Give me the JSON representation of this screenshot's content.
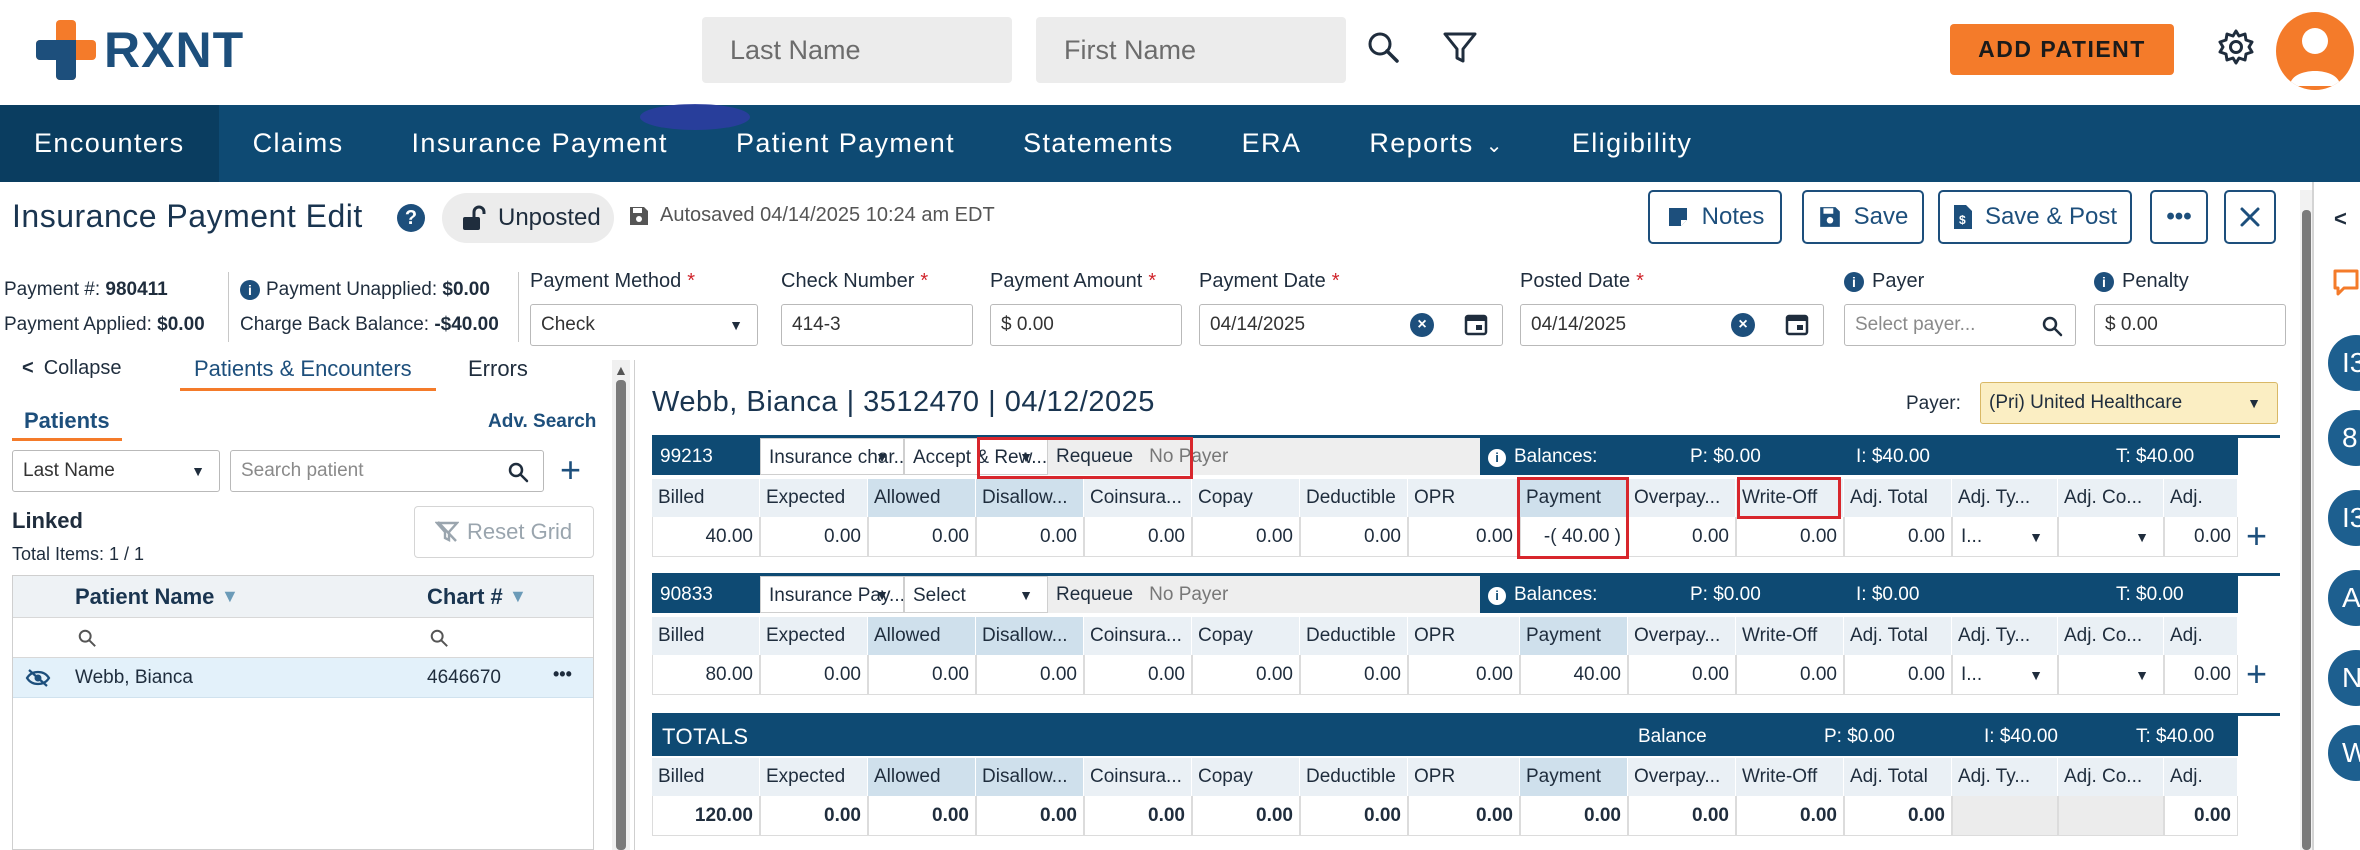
{
  "header": {
    "logo_text": "RXNT",
    "last_name_placeholder": "Last Name",
    "first_name_placeholder": "First Name",
    "add_patient_label": "ADD PATIENT"
  },
  "nav": {
    "items": [
      "Encounters",
      "Claims",
      "Insurance Payment",
      "Patient Payment",
      "Statements",
      "ERA",
      "Reports",
      "Eligibility"
    ],
    "active": "Encounters"
  },
  "page": {
    "title": "Insurance Payment Edit",
    "status": "Unposted",
    "autosaved": "Autosaved 04/14/2025 10:24 am EDT",
    "buttons": {
      "notes": "Notes",
      "save": "Save",
      "save_post": "Save & Post",
      "more": "•••"
    }
  },
  "summary": {
    "payment_no_label": "Payment #:",
    "payment_no": "980411",
    "payment_applied_label": "Payment Applied:",
    "payment_applied": "$0.00",
    "payment_unapplied_label": "Payment Unapplied:",
    "payment_unapplied": "$0.00",
    "charge_back_label": "Charge Back Balance:",
    "charge_back": "-$40.00"
  },
  "form": {
    "payment_method_label": "Payment Method",
    "payment_method": "Check",
    "check_number_label": "Check Number",
    "check_number": "414-3",
    "payment_amount_label": "Payment Amount",
    "payment_amount": "$ 0.00",
    "payment_date_label": "Payment Date",
    "payment_date": "04/14/2025",
    "posted_date_label": "Posted Date",
    "posted_date": "04/14/2025",
    "payer_label": "Payer",
    "payer_placeholder": "Select payer...",
    "penalty_label": "Penalty",
    "penalty": "$ 0.00",
    "required_mark": "*"
  },
  "left_panel": {
    "collapse": "Collapse",
    "tab_patients_encounters": "Patients & Encounters",
    "tab_errors": "Errors",
    "patients_tab": "Patients",
    "adv_search": "Adv. Search",
    "search_by": "Last Name",
    "search_placeholder": "Search patient",
    "linked": "Linked",
    "total_items": "Total Items: 1 / 1",
    "reset_grid": "Reset Grid",
    "col_patient_name": "Patient Name",
    "col_chart": "Chart #",
    "patient_name": "Webb, Bianca",
    "chart_no": "4646670",
    "row_more": "•••"
  },
  "encounter": {
    "title": "Webb, Bianca | 3512470 | 04/12/2025",
    "payer_label": "Payer:",
    "payer_value": "(Pri) United Healthcare"
  },
  "columns": [
    "Billed",
    "Expected",
    "Allowed",
    "Disallow...",
    "Coinsura...",
    "Copay",
    "Deductible",
    "OPR",
    "Payment",
    "Overpay...",
    "Write-Off",
    "Adj. Total",
    "Adj. Ty...",
    "Adj. Co...",
    "Adj."
  ],
  "lines": [
    {
      "code": "99213",
      "type": "Insurance char...",
      "action": "Accept & Rew...",
      "requeue": "Requeue",
      "requeue_payer": "No Payer",
      "balances": "Balances:",
      "p": "P: $0.00",
      "i": "I: $40.00",
      "t": "T: $40.00",
      "values": [
        "40.00",
        "0.00",
        "0.00",
        "0.00",
        "0.00",
        "0.00",
        "0.00",
        "0.00",
        "-( 40.00 )",
        "0.00",
        "0.00",
        "0.00",
        "I...",
        "",
        "0.00"
      ]
    },
    {
      "code": "90833",
      "type": "Insurance Pay...",
      "action": "Select",
      "requeue": "Requeue",
      "requeue_payer": "No Payer",
      "balances": "Balances:",
      "p": "P: $0.00",
      "i": "I: $0.00",
      "t": "T: $0.00",
      "values": [
        "80.00",
        "0.00",
        "0.00",
        "0.00",
        "0.00",
        "0.00",
        "0.00",
        "0.00",
        "40.00",
        "0.00",
        "0.00",
        "0.00",
        "I...",
        "",
        "0.00"
      ]
    }
  ],
  "totals": {
    "label": "TOTALS",
    "balance_label": "Balance",
    "p": "P: $0.00",
    "i": "I: $40.00",
    "t": "T: $40.00",
    "values": [
      "120.00",
      "0.00",
      "0.00",
      "0.00",
      "0.00",
      "0.00",
      "0.00",
      "0.00",
      "0.00",
      "0.00",
      "0.00",
      "0.00",
      "",
      "",
      "0.00"
    ]
  },
  "rail": {
    "letters": [
      "I3",
      "8",
      "I3",
      "A",
      "N",
      "W"
    ]
  },
  "colors": {
    "brand_orange": "#f47b2a",
    "brand_navy": "#0e4a73",
    "highlight_red": "#d8262c"
  },
  "icons": [
    "search-icon",
    "filter-icon",
    "gear-icon",
    "avatar-icon",
    "unlock-icon",
    "save-icon",
    "notes-icon",
    "close-icon",
    "calendar-icon",
    "info-icon",
    "eye-slash-icon",
    "chevron-down-icon",
    "plus-icon",
    "comment-icon"
  ]
}
